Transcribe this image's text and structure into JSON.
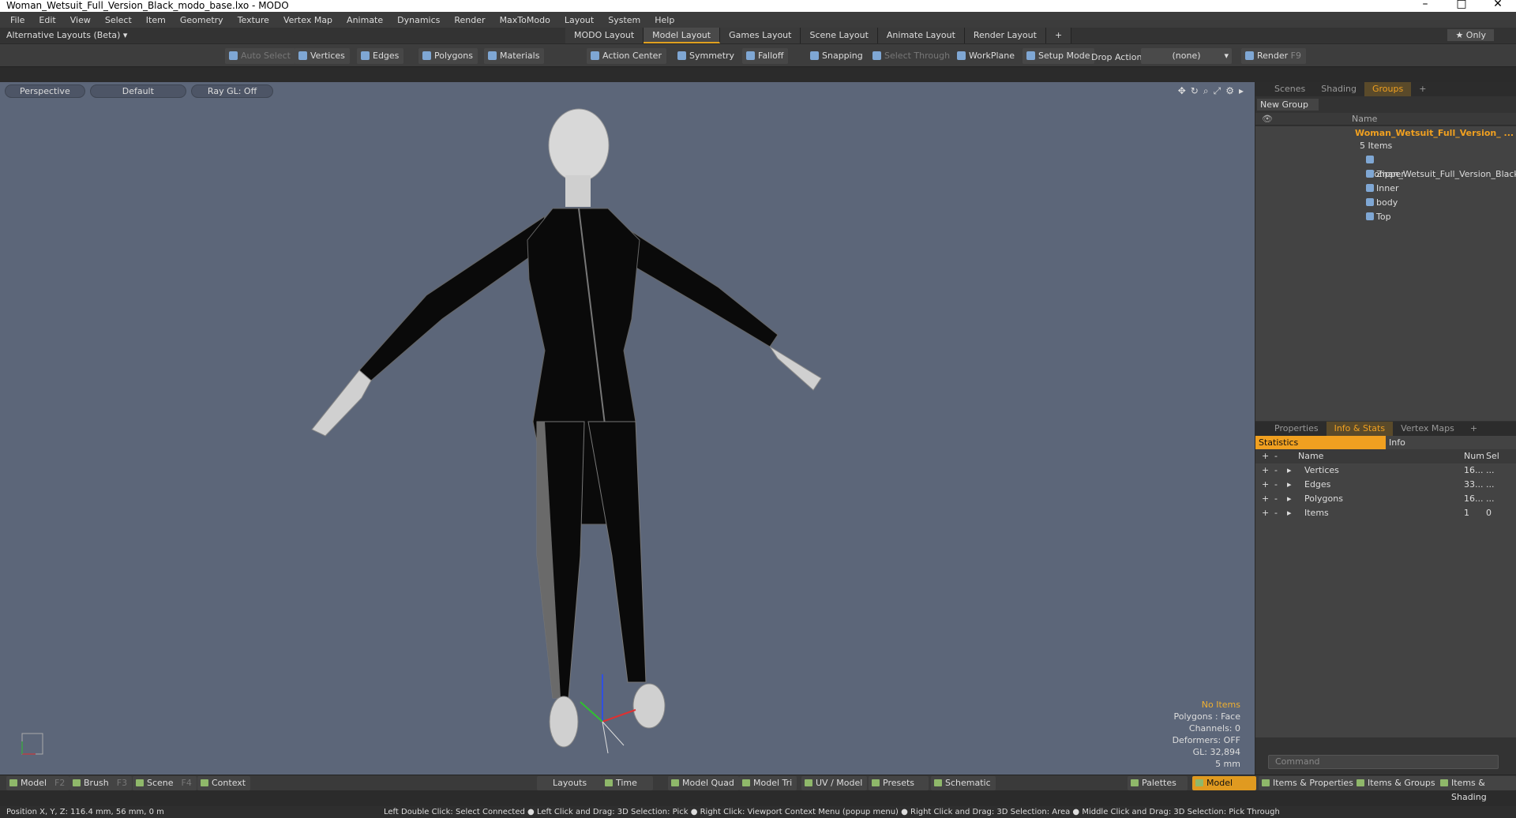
{
  "window": {
    "title": "Woman_Wetsuit_Full_Version_Black_modo_base.lxo - MODO"
  },
  "menu": [
    "File",
    "Edit",
    "View",
    "Select",
    "Item",
    "Geometry",
    "Texture",
    "Vertex Map",
    "Animate",
    "Dynamics",
    "Render",
    "MaxToModo",
    "Layout",
    "System",
    "Help"
  ],
  "layouts": {
    "alt": "Alternative Layouts (Beta) ▾",
    "tabs": [
      "MODO Layout",
      "Model Layout",
      "Games Layout",
      "Scene Layout",
      "Animate Layout",
      "Render Layout"
    ],
    "add": "+",
    "only": "★ Only"
  },
  "toolbar": {
    "auto_select": "Auto Select",
    "vertices": "Vertices",
    "edges": "Edges",
    "polygons": "Polygons",
    "materials": "Materials",
    "action_center": "Action Center",
    "symmetry": "Symmetry",
    "falloff": "Falloff",
    "snapping": "Snapping",
    "select_through": "Select Through",
    "workplane": "WorkPlane",
    "setup_mode": "Setup Mode",
    "drop_action": "Drop Action",
    "drop_value": "(none)",
    "render": "Render",
    "render_key": "F9"
  },
  "viewport": {
    "perspective": "Perspective",
    "default": "Default",
    "raygl": "Ray GL: Off",
    "info": {
      "no_items": "No Items",
      "polygons": "Polygons : Face",
      "channels": "Channels: 0",
      "deformers": "Deformers: OFF",
      "gl": "GL: 32,894",
      "unit": "5 mm"
    }
  },
  "groups": {
    "tabs": [
      "Scenes",
      "Shading",
      "Groups"
    ],
    "new_group": "New Group",
    "col_name": "Name",
    "group_name": "Woman_Wetsuit_Full_Version_ ...",
    "count": "5 Items",
    "items": [
      "Woman_Wetsuit_Full_Version_Black",
      "Zipper",
      "Inner",
      "body",
      "Top"
    ]
  },
  "props": {
    "tabs": [
      "Properties",
      "Info & Stats",
      "Vertex Maps"
    ],
    "statistics": "Statistics",
    "info": "Info",
    "cols": {
      "name": "Name",
      "num": "Num",
      "sel": "Sel"
    },
    "rows": [
      {
        "name": "Vertices",
        "num": "16...",
        "sel": "..."
      },
      {
        "name": "Edges",
        "num": "33...",
        "sel": "..."
      },
      {
        "name": "Polygons",
        "num": "16...",
        "sel": "..."
      },
      {
        "name": "Items",
        "num": "1",
        "sel": "0"
      }
    ],
    "command": "Command"
  },
  "bottom": {
    "model": "Model",
    "model_key": "F2",
    "brush": "Brush",
    "brush_key": "F3",
    "scene": "Scene",
    "scene_key": "F4",
    "context": "Context",
    "layouts": "Layouts",
    "time": "Time",
    "model_quad": "Model Quad",
    "model_tri": "Model Tri",
    "uv_model": "UV / Model",
    "presets": "Presets",
    "schematic": "Schematic",
    "palettes": "Palettes",
    "model2": "Model",
    "items_props": "Items & Properties",
    "items_groups": "Items & Groups",
    "items_shading": "Items & Shading"
  },
  "status": {
    "position": "Position X, Y, Z:   116.4 mm, 56 mm, 0 m",
    "hints": "Left Double Click: Select Connected ● Left Click and Drag: 3D Selection: Pick ● Right Click: Viewport Context Menu (popup menu) ● Right Click and Drag: 3D Selection: Area ● Middle Click and Drag: 3D Selection: Pick Through"
  }
}
